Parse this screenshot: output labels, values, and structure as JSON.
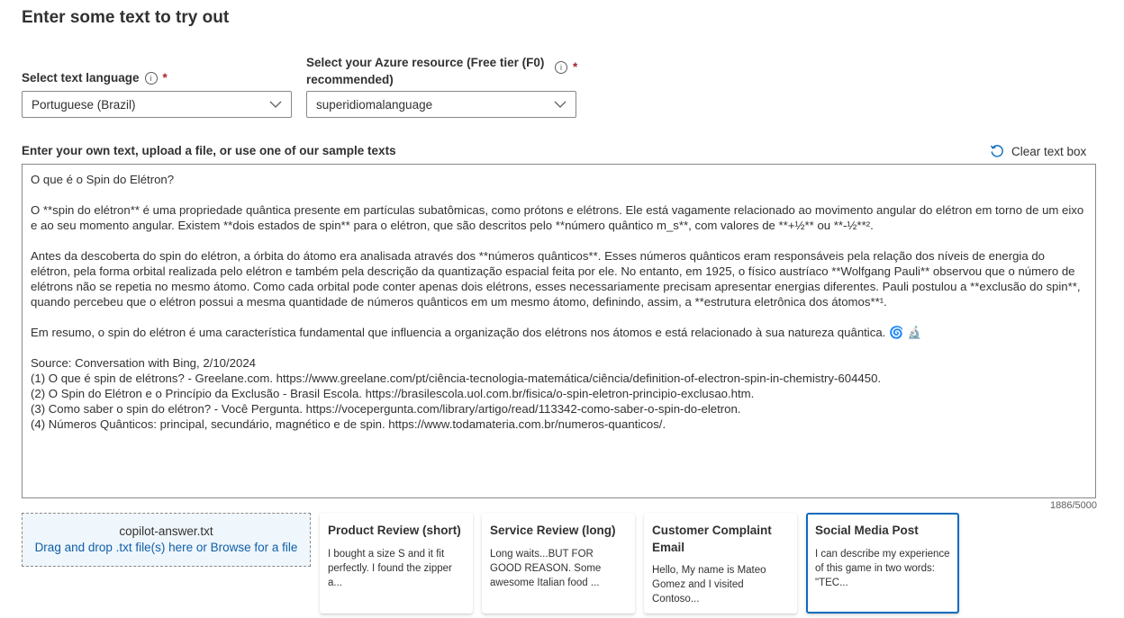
{
  "header": {
    "title": "Enter some text to try out"
  },
  "language": {
    "label": "Select text language",
    "info_icon": "info-icon",
    "required_mark": "*",
    "selected": "Portuguese (Brazil)"
  },
  "resource": {
    "label_line1": "Select your Azure resource (Free tier (F0)",
    "label_line2": "recommended)",
    "required_mark": "*",
    "selected": "superidiomalanguage"
  },
  "input_section": {
    "label": "Enter your own text, upload a file, or use one of our sample texts",
    "clear_label": "Clear text box",
    "counter": "1886/5000"
  },
  "text_content": {
    "p1": "O que é o Spin do Elétron?",
    "p2": "O **spin do elétron** é uma propriedade quântica presente em partículas subatômicas, como prótons e elétrons. Ele está vagamente relacionado ao movimento angular do elétron em torno de um eixo e ao seu momento angular. Existem **dois estados de spin** para o elétron, que são descritos pelo **número quântico m_s**, com valores de **+½** ou **-½**².",
    "p3": "Antes da descoberta do spin do elétron, a órbita do átomo era analisada através dos **números quânticos**. Esses números quânticos eram responsáveis pela relação dos níveis de energia do elétron, pela forma orbital realizada pelo elétron e também pela descrição da quantização espacial feita por ele. No entanto, em 1925, o físico austríaco **Wolfgang Pauli** observou que o número de elétrons não se repetia no mesmo átomo. Como cada orbital pode conter apenas dois elétrons, esses necessariamente precisam apresentar energias diferentes. Pauli postulou a **exclusão do spin**, quando percebeu que o elétron possui a mesma quantidade de números quânticos em um mesmo átomo, definindo, assim, a **estrutura eletrônica dos átomos**¹.",
    "p4": "Em resumo, o spin do elétron é uma característica fundamental que influencia a organização dos elétrons nos átomos e está relacionado à sua natureza quântica. 🌀 🔬",
    "s0": "Source: Conversation with Bing, 2/10/2024",
    "s1": "(1) O que é spin de elétrons? - Greelane.com. https://www.greelane.com/pt/ciência-tecnologia-matemática/ciência/definition-of-electron-spin-in-chemistry-604450.",
    "s2": "(2) O Spin do Elétron e o Princípio da Exclusão - Brasil Escola. https://brasilescola.uol.com.br/fisica/o-spin-eletron-principio-exclusao.htm.",
    "s3": "(3) Como saber o spin do elétron? - Você Pergunta. https://vocepergunta.com/library/artigo/read/113342-como-saber-o-spin-do-eletron.",
    "s4": "(4) Números Quânticos: principal, secundário, magnético e de spin. https://www.todamateria.com.br/numeros-quanticos/."
  },
  "upload": {
    "filename": "copilot-answer.txt",
    "hint": "Drag and drop .txt file(s) here or Browse for a file"
  },
  "samples": [
    {
      "title": "Product Review (short)",
      "body": "I bought a size S and it fit perfectly. I found the zipper a..."
    },
    {
      "title": "Service Review (long)",
      "body": "Long waits...BUT FOR GOOD REASON. Some awesome Italian food ..."
    },
    {
      "title": "Customer Complaint Email",
      "body": "Hello, My name is Mateo Gomez and I visited Contoso..."
    },
    {
      "title": "Social Media Post",
      "body": "I can describe my experience of this game in two words: \"TEC..."
    }
  ],
  "colors": {
    "accent": "#0f6cbd",
    "link": "#0f5fa8",
    "required": "#a4262c",
    "upload_bg": "#eff6fc"
  }
}
